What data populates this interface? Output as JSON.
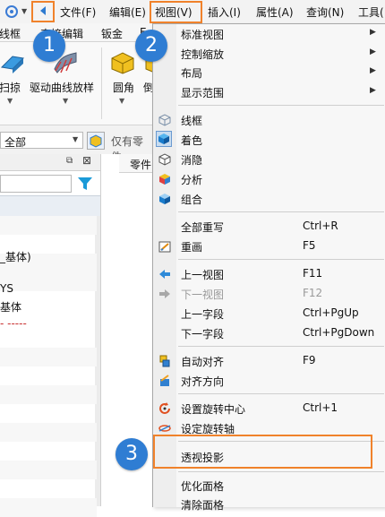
{
  "menubar": {
    "items": [
      {
        "label": "文件(F)"
      },
      {
        "label": "编辑(E)"
      },
      {
        "label": "视图(V)"
      },
      {
        "label": "插入(I)"
      },
      {
        "label": "属性(A)"
      },
      {
        "label": "查询(N)"
      },
      {
        "label": "工具("
      }
    ]
  },
  "ribbon": {
    "tabs": [
      {
        "label": "线框"
      },
      {
        "label": "直接编辑"
      },
      {
        "label": "钣金"
      },
      {
        "label": "E"
      }
    ],
    "buttons": [
      {
        "label": "扫掠",
        "icon": "sweep-icon"
      },
      {
        "label": "驱动曲线放样",
        "icon": "loft-icon"
      },
      {
        "label": "圆角",
        "icon": "fillet-icon"
      },
      {
        "label": "倒",
        "icon": "chamfer-icon"
      }
    ]
  },
  "filter": {
    "select_value": "全部",
    "only_parts_label": "仅有零件"
  },
  "panel": {
    "tab_label": "零件",
    "tree_rows": [
      "",
      "",
      "",
      "_基体)",
      "",
      "YS",
      "基体",
      "- -----",
      "",
      "",
      "",
      "",
      "",
      "",
      "",
      ""
    ]
  },
  "view_menu": {
    "items": [
      {
        "label": "标准视图",
        "submenu": true
      },
      {
        "label": "控制缩放",
        "submenu": true
      },
      {
        "label": "布局",
        "submenu": true
      },
      {
        "label": "显示范围",
        "submenu": true
      },
      {
        "label": "线框",
        "icon": "wireframe-icon"
      },
      {
        "label": "着色",
        "icon": "shaded-icon"
      },
      {
        "label": "消隐",
        "icon": "hidden-line-icon"
      },
      {
        "label": "分析",
        "icon": "analysis-icon"
      },
      {
        "label": "组合",
        "icon": "combine-icon"
      },
      {
        "label": "全部重写",
        "shortcut": "Ctrl+R"
      },
      {
        "label": "重画",
        "shortcut": "F5",
        "icon": "redraw-icon"
      },
      {
        "label": "上一视图",
        "shortcut": "F11",
        "icon": "prev-view-icon"
      },
      {
        "label": "下一视图",
        "shortcut": "F12",
        "icon": "next-view-icon",
        "disabled": true
      },
      {
        "label": "上一字段",
        "shortcut": "Ctrl+PgUp"
      },
      {
        "label": "下一字段",
        "shortcut": "Ctrl+PgDown"
      },
      {
        "label": "自动对齐",
        "shortcut": "F9",
        "icon": "auto-align-icon"
      },
      {
        "label": "对齐方向",
        "icon": "align-direction-icon"
      },
      {
        "label": "设置旋转中心",
        "shortcut": "Ctrl+1",
        "icon": "rotation-center-icon"
      },
      {
        "label": "设定旋转轴",
        "icon": "rotation-axis-icon"
      },
      {
        "label": "透视投影"
      },
      {
        "label": "优化面格"
      },
      {
        "label": "清除面格"
      }
    ]
  },
  "callouts": [
    "1",
    "2",
    "3"
  ],
  "colors": {
    "highlight": "#f0822b",
    "badge": "#2f7dd3",
    "accent": "#2e7bd0"
  }
}
